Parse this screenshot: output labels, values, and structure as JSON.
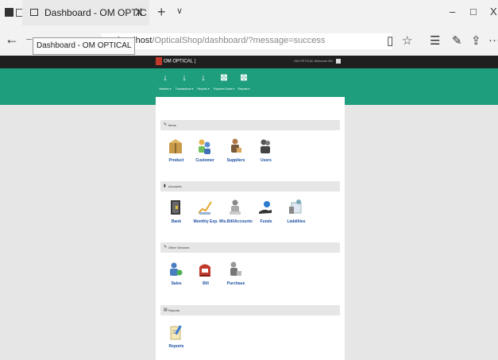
{
  "browser": {
    "tab_title": "Dashboard - OM OPTIC",
    "tab_close": "X",
    "new_tab": "+",
    "tab_menu": "∨",
    "tooltip": "Dashboard - OM OPTICAL",
    "url_host": "localhost",
    "url_path": "/OpticalShop/dashboard/?message=success",
    "back": "←",
    "win_min": "–",
    "win_max": "□",
    "win_close": "X",
    "more": "···"
  },
  "app": {
    "brand": "OM OPTICAL",
    "brand_sub": "|",
    "top_right": "OM OPTICAL   Welcome Bill"
  },
  "nav": [
    {
      "label": "Masters ▾",
      "icon": "↓"
    },
    {
      "label": "Transactions ▾",
      "icon": "↓"
    },
    {
      "label": "Reports ▾",
      "icon": "↓"
    },
    {
      "label": "Payment Voice ▾",
      "icon": "⊠"
    },
    {
      "label": "Reports ▾",
      "icon": "⊠"
    }
  ],
  "sections": [
    {
      "title": "Items",
      "icon": "✎",
      "items": [
        "Product",
        "Customer",
        "Suppliers",
        "Users"
      ]
    },
    {
      "title": "Accounts",
      "icon": "▮",
      "items": [
        "Bank",
        "Monthly Exp.",
        "Mis.Bill/Accounts",
        "Funds",
        "Liabilities"
      ]
    },
    {
      "title": "Other Services",
      "icon": "✎",
      "items": [
        "Sales",
        "Bill",
        "Purchase"
      ]
    },
    {
      "title": "Reports",
      "icon": "▤",
      "items": [
        "Reports"
      ]
    }
  ],
  "colors": {
    "green": "#1e9e7c",
    "topbar": "#1f1f1f",
    "link": "#1b4fa0"
  }
}
